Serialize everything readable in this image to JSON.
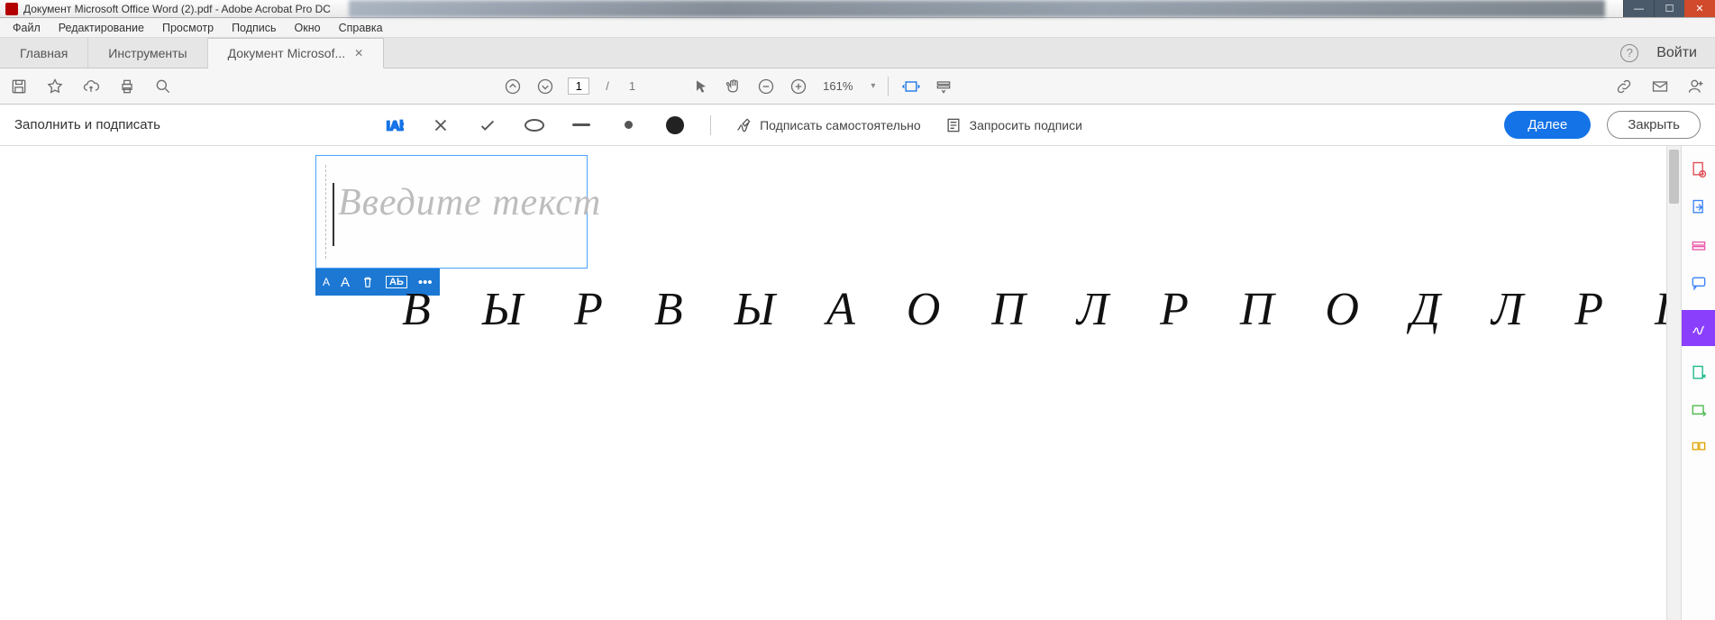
{
  "window": {
    "title": "Документ Microsoft Office Word (2).pdf - Adobe Acrobat Pro DC"
  },
  "menu": {
    "file": "Файл",
    "edit": "Редактирование",
    "view": "Просмотр",
    "sign": "Подпись",
    "window": "Окно",
    "help": "Справка"
  },
  "tabs": {
    "home": "Главная",
    "tools": "Инструменты",
    "doc": "Документ Microsof...",
    "signin": "Войти"
  },
  "paging": {
    "current": "1",
    "total": "1",
    "zoom": "161%"
  },
  "fill": {
    "title": "Заполнить и подписать",
    "self_sign": "Подписать самостоятельно",
    "request": "Запросить подписи",
    "next": "Далее",
    "close": "Закрыть"
  },
  "field": {
    "placeholder": "Введите текст",
    "style_box": "AЬ"
  },
  "page_text": "В Ы Р В Ы А О П Л Р П О Д Л Р П"
}
